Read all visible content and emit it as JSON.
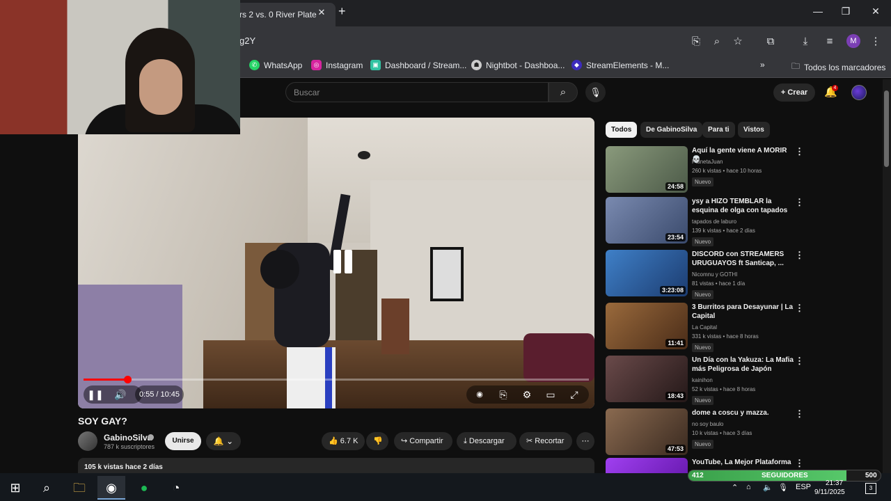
{
  "browser": {
    "tab_title": "rs 2 vs. 0 River Plate",
    "url_fragment": "g2Y",
    "profile_initial": "M",
    "bookmarks": [
      {
        "label": "WhatsApp",
        "icon": "whatsapp-icon",
        "color": "#25d366"
      },
      {
        "label": "Instagram",
        "icon": "instagram-icon",
        "color": "#d6249f"
      },
      {
        "label": "Dashboard / Stream...",
        "icon": "streamlabs-icon",
        "color": "#31c3a2"
      },
      {
        "label": "Nightbot - Dashboa...",
        "icon": "nightbot-icon",
        "color": "#cccccc"
      },
      {
        "label": "StreamElements - M...",
        "icon": "streamelements-icon",
        "color": "#3d2bbd"
      }
    ],
    "all_bookmarks": "Todos los marcadores"
  },
  "youtube": {
    "search_placeholder": "Buscar",
    "create_label": "Crear",
    "notif_count": "4",
    "video": {
      "time": "0:55 / 10:45",
      "progress": 0.0873
    },
    "title": "SOY GAY?",
    "channel": {
      "name": "GabinoSilva",
      "subs": "787 k suscriptores",
      "join_label": "Unirse"
    },
    "actions": {
      "likes": "6.7 K",
      "share": "Compartir",
      "download": "Descargar",
      "clip": "Recortar"
    },
    "description_meta": "105 k vistas  hace 2 días",
    "chips": [
      "Todos",
      "De GabinoSilva",
      "Para ti",
      "Vistos"
    ],
    "recommended": [
      {
        "title": "Aquí la gente viene A MORIR 💀",
        "channel": "PlanetaJuan",
        "meta": "260 k vistas • hace 10 horas",
        "badge": "Nuevo",
        "duration": "24:58",
        "thumb": "#6c7a64"
      },
      {
        "title": "ysy a HIZO TEMBLAR la esquina de olga con tapados de laburo",
        "channel": "tapados de laburo",
        "meta": "139 k vistas • hace 2 días",
        "badge": "Nuevo",
        "duration": "23:54",
        "thumb": "#5a6b8c"
      },
      {
        "title": "DISCORD con STREAMERS URUGUAYOS ft Santicap, ...",
        "channel": "Nicomnu y GOTHI",
        "meta": "81 vistas • hace 1 día",
        "badge": "Nuevo",
        "duration": "3:23:08",
        "thumb": "#2f6aa8"
      },
      {
        "title": "3 Burritos para Desayunar | La Capital",
        "channel": "La Capital",
        "meta": "331 k vistas • hace 8 horas",
        "badge": "Nuevo",
        "duration": "11:41",
        "thumb": "#7a5330"
      },
      {
        "title": "Un Día con la Yakuza: La Mafia más Peligrosa de Japón",
        "channel": "kainihon",
        "meta": "52 k vistas • hace 8 horas",
        "badge": "Nuevo",
        "duration": "18:43",
        "thumb": "#4a3a3a"
      },
      {
        "title": "dome a coscu y mazza.",
        "channel": "no soy baulo",
        "meta": "10 k vistas • hace 3 días",
        "badge": "Nuevo",
        "duration": "47:53",
        "thumb": "#6a5040"
      },
      {
        "title": "YouTube, La Mejor Plataforma",
        "channel": "",
        "meta": "",
        "badge": "",
        "duration": "",
        "thumb": "#8a2bd0"
      }
    ]
  },
  "overlay": {
    "followers_current": "412",
    "followers_label": "SEGUIDORES",
    "followers_goal": "500",
    "followers_fraction": 0.824
  },
  "taskbar": {
    "language": "ESP",
    "time": "21:37",
    "date": "9/11/2025",
    "notifications": "3"
  }
}
